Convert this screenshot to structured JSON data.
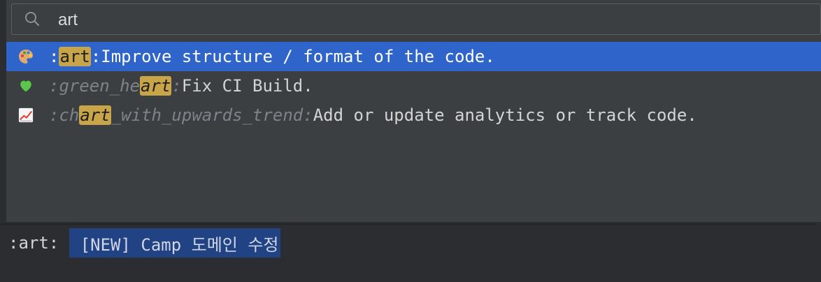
{
  "search": {
    "query": "art"
  },
  "results": [
    {
      "emoji": "palette-icon",
      "code_prefix": ":",
      "code_match": "art",
      "code_suffix": ":",
      "description": " Improve structure / format of the code."
    },
    {
      "emoji": "green-heart-icon",
      "code_prefix": ":green_he",
      "code_match": "art",
      "code_suffix": ":",
      "description": " Fix CI Build."
    },
    {
      "emoji": "chart-upwards-icon",
      "code_prefix": ":ch",
      "code_match": "art",
      "code_suffix": "_with_upwards_trend:",
      "description": " Add or update analytics or track code."
    }
  ],
  "editor": {
    "prefix": ":art: ",
    "selected_text": "[NEW] Camp 도메인 수정"
  },
  "colors": {
    "selection": "#2f65ca",
    "highlight": "#c9a54a",
    "editor_selection": "#214283"
  }
}
